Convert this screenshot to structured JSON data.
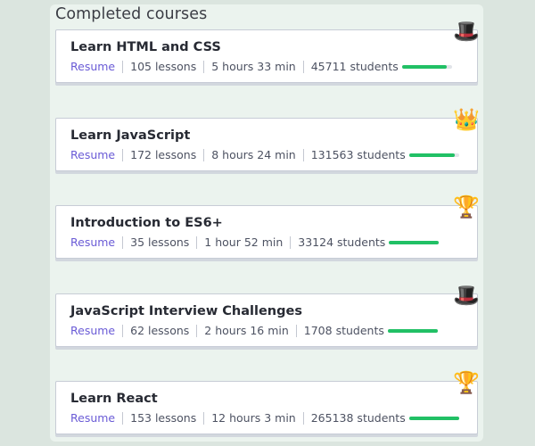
{
  "section": {
    "title": "Completed courses"
  },
  "resume_label": "Resume",
  "courses": [
    {
      "title": "Learn HTML and CSS",
      "lessons": "105 lessons",
      "duration": "5 hours 33 min",
      "students": "45711 students",
      "progress": 0.9,
      "badge": "top-hat-icon",
      "badge_glyph": "🎩"
    },
    {
      "title": "Learn JavaScript",
      "lessons": "172 lessons",
      "duration": "8 hours 24 min",
      "students": "131563 students",
      "progress": 0.92,
      "badge": "crown-icon",
      "badge_glyph": "👑"
    },
    {
      "title": "Introduction to ES6+",
      "lessons": "35 lessons",
      "duration": "1 hour 52 min",
      "students": "33124 students",
      "progress": 1.0,
      "badge": "trophy-icon",
      "badge_glyph": "🏆"
    },
    {
      "title": "JavaScript Interview Challenges",
      "lessons": "62 lessons",
      "duration": "2 hours 16 min",
      "students": "1708 students",
      "progress": 1.0,
      "badge": "top-hat-icon",
      "badge_glyph": "🎩"
    },
    {
      "title": "Learn React",
      "lessons": "153 lessons",
      "duration": "12 hours 3 min",
      "students": "265138 students",
      "progress": 1.0,
      "badge": "trophy-icon",
      "badge_glyph": "🏆"
    }
  ],
  "colors": {
    "accent": "#6a5bd6",
    "progress": "#21c065",
    "background": "#dbe5df"
  }
}
